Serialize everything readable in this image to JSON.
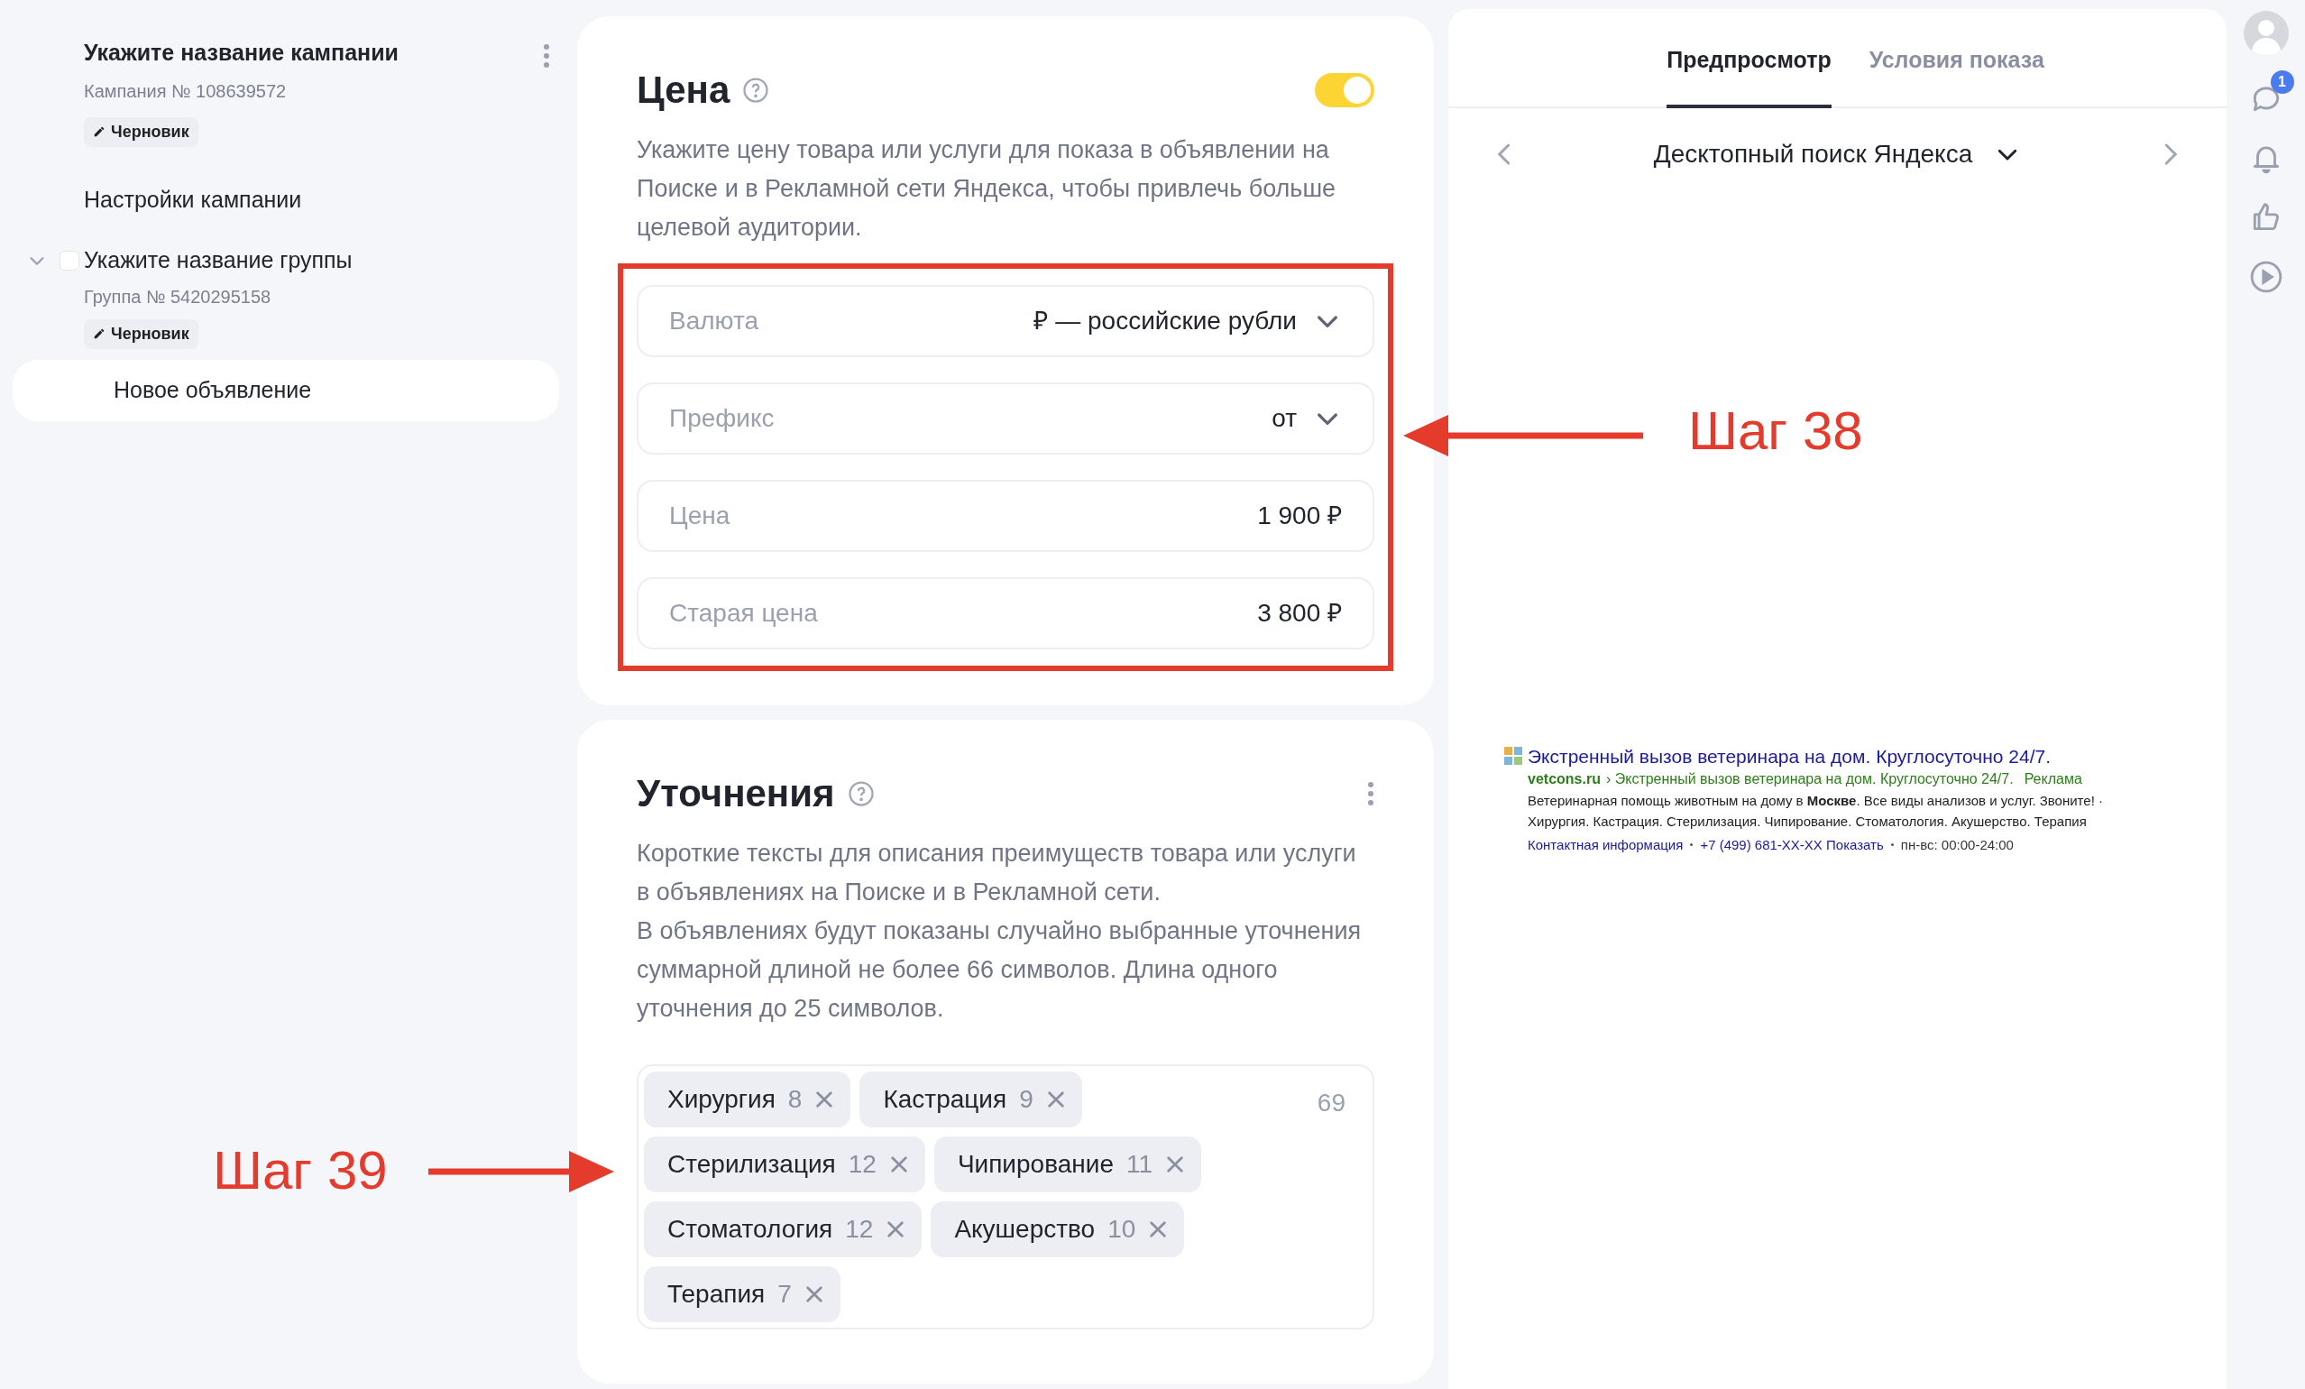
{
  "sidebar": {
    "campaign": {
      "title": "Укажите название кампании",
      "number": "Кампания № 108639572",
      "status": "Черновик"
    },
    "settings_link": "Настройки кампании",
    "group": {
      "title": "Укажите название группы",
      "number": "Группа № 5420295158",
      "status": "Черновик",
      "expanded": true,
      "checked": false
    },
    "ad": {
      "title": "Новое объявление",
      "selected": true
    }
  },
  "price": {
    "title": "Цена",
    "enabled": true,
    "description": "Укажите цену товара или услуги для показа в объявлении на Поиске и в Рекламной сети Яндекса, чтобы привлечь больше целевой аудитории.",
    "fields": [
      {
        "kind": "select",
        "label": "Валюта",
        "value": "₽ — российские рубли"
      },
      {
        "kind": "select",
        "label": "Префикс",
        "value": "от"
      },
      {
        "kind": "input",
        "label": "Цена",
        "value": "1 900  ₽"
      },
      {
        "kind": "input",
        "label": "Старая цена",
        "value": "3 800  ₽"
      }
    ]
  },
  "refinements": {
    "title": "Уточнения",
    "description": [
      "Короткие тексты для описания преимуществ товара или услуги в объявлениях на Поиске и в Рекламной сети.",
      "В объявлениях будут показаны случайно выбранные уточнения суммарной длиной не более 66 символов. Длина одного уточнения до 25 символов."
    ],
    "remaining": "69",
    "tags": [
      {
        "text": "Хирургия",
        "count": "8"
      },
      {
        "text": "Кастрация",
        "count": "9"
      },
      {
        "text": "Стерилизация",
        "count": "12"
      },
      {
        "text": "Чипирование",
        "count": "11"
      },
      {
        "text": "Стоматология",
        "count": "12"
      },
      {
        "text": "Акушерство",
        "count": "10"
      },
      {
        "text": "Терапия",
        "count": "7"
      }
    ]
  },
  "preview": {
    "tabs": [
      {
        "label": "Предпросмотр",
        "selected": true
      },
      {
        "label": "Условия показа",
        "selected": false
      }
    ],
    "platform": "Десктопный поиск Яндекса",
    "ad": {
      "title": "Экстренный вызов ветеринара на дом. Круглосуточно 24/7.",
      "domain": "vetcons.ru",
      "path": "› Экстренный вызов ветеринара на дом. Круглосуточно 24/7.",
      "label": "Реклама",
      "text": "Ветеринарная помощь животным на дому в **Москве**. Все виды анализов и услуг. Звоните! · Хирургия. Кастрация. Стерилизация. Чипирование. Стоматология. Акушерство. Терапия",
      "contact": "Контактная информация",
      "phone": "+7 (499) 681-XX-XX Показать",
      "hours": "пн-вс: 00:00-24:00"
    }
  },
  "rail": {
    "messages_badge": "1"
  },
  "annotations": [
    {
      "text": "Шаг 38"
    },
    {
      "text": "Шаг 39"
    }
  ]
}
